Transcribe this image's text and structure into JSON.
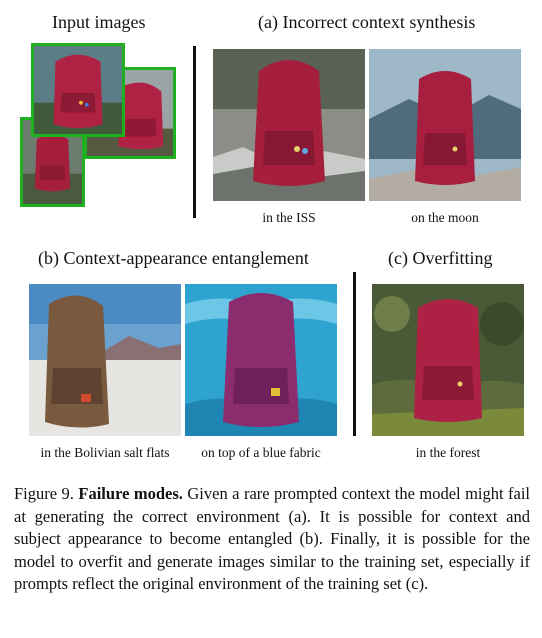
{
  "sections": {
    "input": {
      "title": "Input images"
    },
    "incorrect_context": {
      "title": "(a) Incorrect context synthesis",
      "captions": [
        "in the ISS",
        "on the moon"
      ]
    },
    "entanglement": {
      "title": "(b) Context-appearance entanglement",
      "captions": [
        "in the Bolivian salt flats",
        "on top of a blue fabric"
      ]
    },
    "overfitting": {
      "title": "(c) Overfitting",
      "captions": [
        "in the forest"
      ]
    }
  },
  "figure_caption": {
    "label": "Figure 9.",
    "bold": "Failure modes.",
    "text": "Given a rare prompted context the model might fail at generating the correct environment (a). It is possible for context and subject appearance to become entangled (b). Finally, it is possible for the model to overfit and generate images similar to the training set, especially if prompts reflect the original environment of the training set (c)."
  },
  "colors": {
    "thumb_border": "#1fb01f",
    "backpack_red": "#a51f3c",
    "backpack_brown": "#7a5a3e",
    "backpack_purple": "#8a2c6e"
  }
}
